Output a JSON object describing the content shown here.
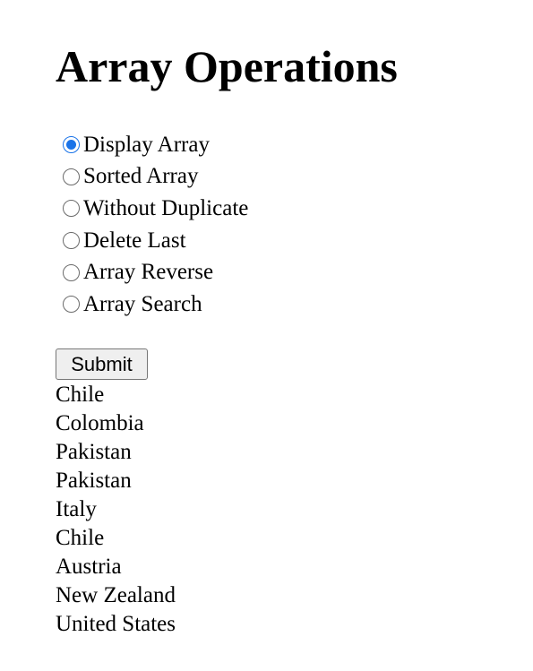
{
  "page": {
    "title": "Array Operations"
  },
  "form": {
    "options": [
      {
        "label": "Display Array",
        "checked": true
      },
      {
        "label": "Sorted Array",
        "checked": false
      },
      {
        "label": "Without Duplicate",
        "checked": false
      },
      {
        "label": "Delete Last",
        "checked": false
      },
      {
        "label": "Array Reverse",
        "checked": false
      },
      {
        "label": "Array Search",
        "checked": false
      }
    ],
    "submit_label": "Submit",
    "accent_color": "#1a73e8"
  },
  "results": [
    "Chile",
    "Colombia",
    "Pakistan",
    "Pakistan",
    "Italy",
    "Chile",
    "Austria",
    "New Zealand",
    "United States"
  ]
}
